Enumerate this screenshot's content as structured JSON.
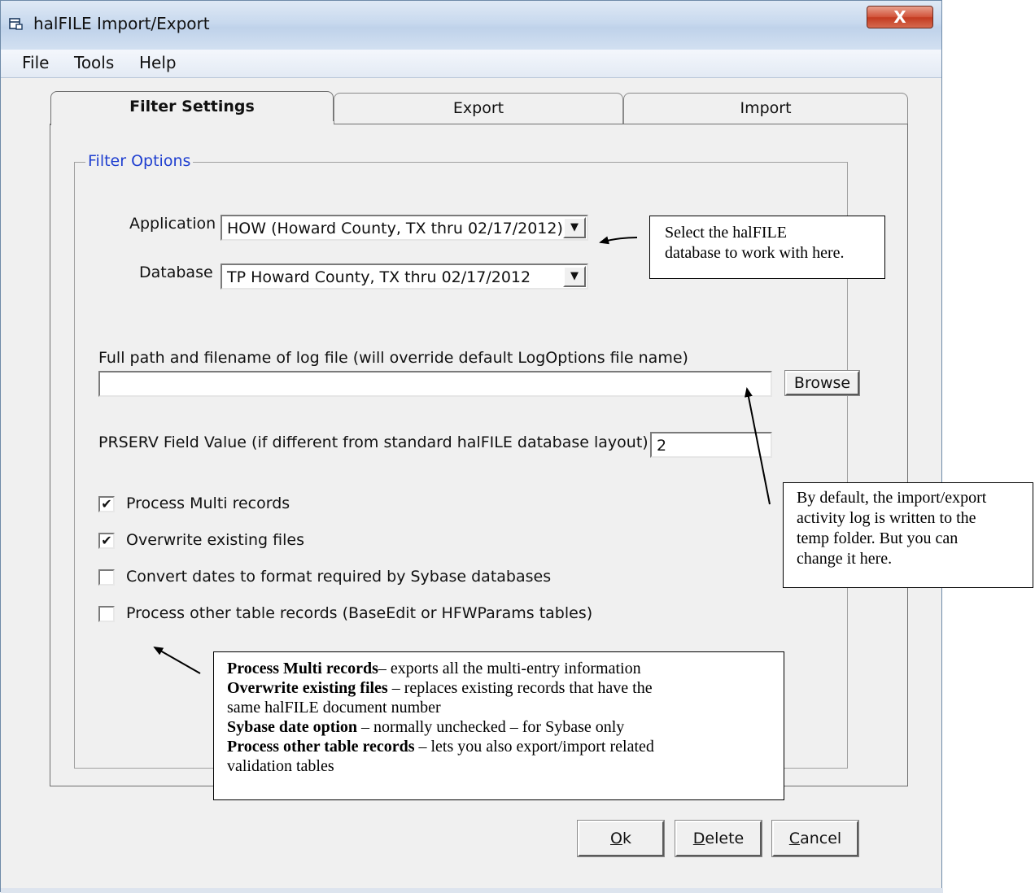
{
  "window": {
    "title": "halFILE Import/Export",
    "close_label": "X"
  },
  "menu": [
    "File",
    "Tools",
    "Help"
  ],
  "tabs": [
    "Filter Settings",
    "Export",
    "Import"
  ],
  "filter_options": {
    "group_label": "Filter Options",
    "application_label": "Application",
    "application_value": "HOW  (Howard County, TX thru 02/17/2012)",
    "database_label": "Database",
    "database_value": "TP Howard County, TX thru 02/17/2012",
    "log_file_label": "Full path and filename of log file (will override default LogOptions file name)",
    "log_file_value": "",
    "browse_label": "Browse",
    "prserv_label": "PRSERV Field Value (if different from standard halFILE database layout):",
    "prserv_value": "2",
    "checkboxes": [
      {
        "label": "Process Multi records",
        "checked": true
      },
      {
        "label": "Overwrite existing files",
        "checked": true
      },
      {
        "label": "Convert dates to format required by Sybase databases",
        "checked": false
      },
      {
        "label": "Process other table records (BaseEdit or HFWParams tables)",
        "checked": false
      }
    ]
  },
  "buttons": {
    "ok_rest": "k",
    "ok_key": "O",
    "delete_key": "D",
    "delete_rest": "elete",
    "cancel_key": "C",
    "cancel_rest": "ancel"
  },
  "callouts": {
    "database": {
      "line1": "Select the halFILE",
      "line2": "database to work with here."
    },
    "log": {
      "line1": "By default, the import/export",
      "line2": "activity log is written to the",
      "line3": "temp folder. But you can",
      "line4": "change it here."
    },
    "options": {
      "multi_bold": "Process Multi records",
      "multi_text": "– exports all the multi-entry information",
      "overwrite_bold": "Overwrite existing files",
      "overwrite_text": " – replaces existing records that have the",
      "overwrite_text2": "same halFILE document number",
      "sybase_bold": "Sybase date option",
      "sybase_text": " – normally unchecked – for Sybase only",
      "other_bold": "Process other table records",
      "other_text": " – lets you also export/import related",
      "other_text2": "validation tables"
    }
  },
  "check_mark": "✔",
  "dropdown_arrow": "▼"
}
